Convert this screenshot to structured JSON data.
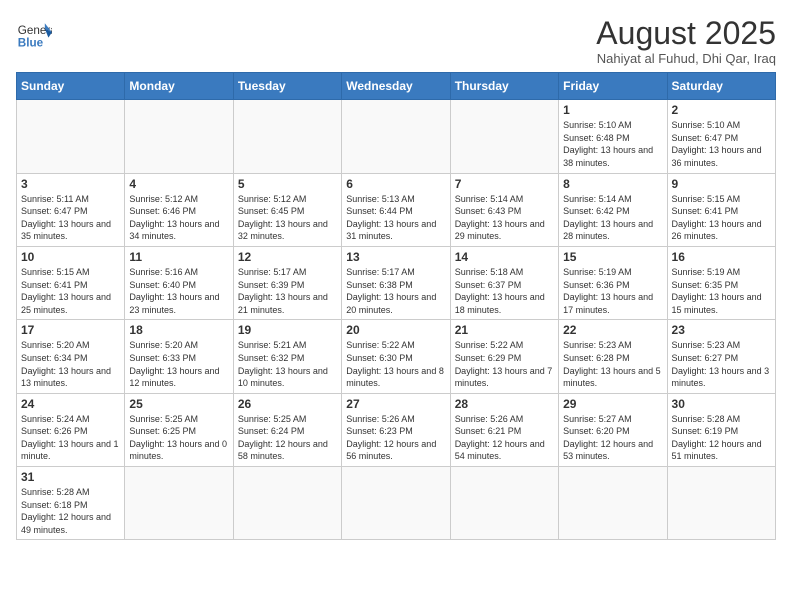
{
  "logo": {
    "line1": "General",
    "line2": "Blue"
  },
  "header": {
    "month": "August 2025",
    "location": "Nahiyat al Fuhud, Dhi Qar, Iraq"
  },
  "weekdays": [
    "Sunday",
    "Monday",
    "Tuesday",
    "Wednesday",
    "Thursday",
    "Friday",
    "Saturday"
  ],
  "weeks": [
    [
      {
        "day": "",
        "info": ""
      },
      {
        "day": "",
        "info": ""
      },
      {
        "day": "",
        "info": ""
      },
      {
        "day": "",
        "info": ""
      },
      {
        "day": "",
        "info": ""
      },
      {
        "day": "1",
        "info": "Sunrise: 5:10 AM\nSunset: 6:48 PM\nDaylight: 13 hours and 38 minutes."
      },
      {
        "day": "2",
        "info": "Sunrise: 5:10 AM\nSunset: 6:47 PM\nDaylight: 13 hours and 36 minutes."
      }
    ],
    [
      {
        "day": "3",
        "info": "Sunrise: 5:11 AM\nSunset: 6:47 PM\nDaylight: 13 hours and 35 minutes."
      },
      {
        "day": "4",
        "info": "Sunrise: 5:12 AM\nSunset: 6:46 PM\nDaylight: 13 hours and 34 minutes."
      },
      {
        "day": "5",
        "info": "Sunrise: 5:12 AM\nSunset: 6:45 PM\nDaylight: 13 hours and 32 minutes."
      },
      {
        "day": "6",
        "info": "Sunrise: 5:13 AM\nSunset: 6:44 PM\nDaylight: 13 hours and 31 minutes."
      },
      {
        "day": "7",
        "info": "Sunrise: 5:14 AM\nSunset: 6:43 PM\nDaylight: 13 hours and 29 minutes."
      },
      {
        "day": "8",
        "info": "Sunrise: 5:14 AM\nSunset: 6:42 PM\nDaylight: 13 hours and 28 minutes."
      },
      {
        "day": "9",
        "info": "Sunrise: 5:15 AM\nSunset: 6:41 PM\nDaylight: 13 hours and 26 minutes."
      }
    ],
    [
      {
        "day": "10",
        "info": "Sunrise: 5:15 AM\nSunset: 6:41 PM\nDaylight: 13 hours and 25 minutes."
      },
      {
        "day": "11",
        "info": "Sunrise: 5:16 AM\nSunset: 6:40 PM\nDaylight: 13 hours and 23 minutes."
      },
      {
        "day": "12",
        "info": "Sunrise: 5:17 AM\nSunset: 6:39 PM\nDaylight: 13 hours and 21 minutes."
      },
      {
        "day": "13",
        "info": "Sunrise: 5:17 AM\nSunset: 6:38 PM\nDaylight: 13 hours and 20 minutes."
      },
      {
        "day": "14",
        "info": "Sunrise: 5:18 AM\nSunset: 6:37 PM\nDaylight: 13 hours and 18 minutes."
      },
      {
        "day": "15",
        "info": "Sunrise: 5:19 AM\nSunset: 6:36 PM\nDaylight: 13 hours and 17 minutes."
      },
      {
        "day": "16",
        "info": "Sunrise: 5:19 AM\nSunset: 6:35 PM\nDaylight: 13 hours and 15 minutes."
      }
    ],
    [
      {
        "day": "17",
        "info": "Sunrise: 5:20 AM\nSunset: 6:34 PM\nDaylight: 13 hours and 13 minutes."
      },
      {
        "day": "18",
        "info": "Sunrise: 5:20 AM\nSunset: 6:33 PM\nDaylight: 13 hours and 12 minutes."
      },
      {
        "day": "19",
        "info": "Sunrise: 5:21 AM\nSunset: 6:32 PM\nDaylight: 13 hours and 10 minutes."
      },
      {
        "day": "20",
        "info": "Sunrise: 5:22 AM\nSunset: 6:30 PM\nDaylight: 13 hours and 8 minutes."
      },
      {
        "day": "21",
        "info": "Sunrise: 5:22 AM\nSunset: 6:29 PM\nDaylight: 13 hours and 7 minutes."
      },
      {
        "day": "22",
        "info": "Sunrise: 5:23 AM\nSunset: 6:28 PM\nDaylight: 13 hours and 5 minutes."
      },
      {
        "day": "23",
        "info": "Sunrise: 5:23 AM\nSunset: 6:27 PM\nDaylight: 13 hours and 3 minutes."
      }
    ],
    [
      {
        "day": "24",
        "info": "Sunrise: 5:24 AM\nSunset: 6:26 PM\nDaylight: 13 hours and 1 minute."
      },
      {
        "day": "25",
        "info": "Sunrise: 5:25 AM\nSunset: 6:25 PM\nDaylight: 13 hours and 0 minutes."
      },
      {
        "day": "26",
        "info": "Sunrise: 5:25 AM\nSunset: 6:24 PM\nDaylight: 12 hours and 58 minutes."
      },
      {
        "day": "27",
        "info": "Sunrise: 5:26 AM\nSunset: 6:23 PM\nDaylight: 12 hours and 56 minutes."
      },
      {
        "day": "28",
        "info": "Sunrise: 5:26 AM\nSunset: 6:21 PM\nDaylight: 12 hours and 54 minutes."
      },
      {
        "day": "29",
        "info": "Sunrise: 5:27 AM\nSunset: 6:20 PM\nDaylight: 12 hours and 53 minutes."
      },
      {
        "day": "30",
        "info": "Sunrise: 5:28 AM\nSunset: 6:19 PM\nDaylight: 12 hours and 51 minutes."
      }
    ],
    [
      {
        "day": "31",
        "info": "Sunrise: 5:28 AM\nSunset: 6:18 PM\nDaylight: 12 hours and 49 minutes."
      },
      {
        "day": "",
        "info": ""
      },
      {
        "day": "",
        "info": ""
      },
      {
        "day": "",
        "info": ""
      },
      {
        "day": "",
        "info": ""
      },
      {
        "day": "",
        "info": ""
      },
      {
        "day": "",
        "info": ""
      }
    ]
  ]
}
